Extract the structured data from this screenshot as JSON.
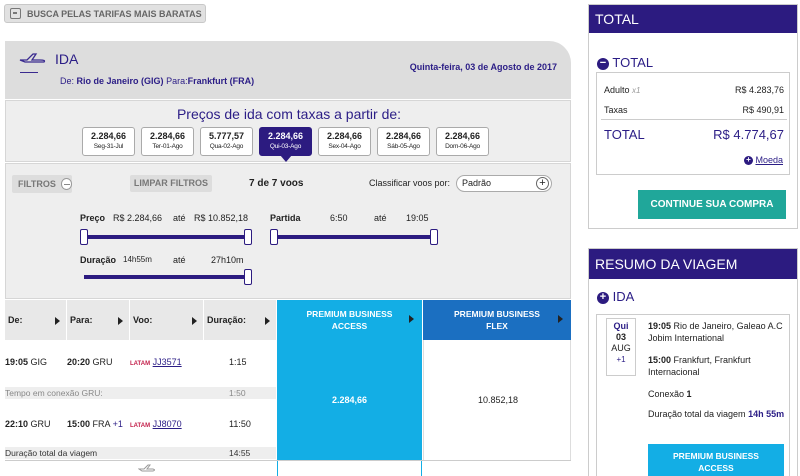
{
  "search_button": {
    "label": "BUSCA PELAS TARIFAS MAIS BARATAS",
    "icon": "calendar-icon"
  },
  "flight_header": {
    "title": "IDA",
    "route_prefix": "De:",
    "origin": "Rio de Janeiro (GIG)",
    "route_mid": "Para:",
    "destination": "Frankfurt (FRA)",
    "date": "Quinta-feira, 03 de Agosto de 2017"
  },
  "prices": {
    "title": "Preços de ida com taxas a partir de:",
    "dates": [
      {
        "price": "2.284,66",
        "day": "Seg-31-Jul",
        "active": false
      },
      {
        "price": "2.284,66",
        "day": "Ter-01-Ago",
        "active": false
      },
      {
        "price": "5.777,57",
        "day": "Qua-02-Ago",
        "active": false
      },
      {
        "price": "2.284,66",
        "day": "Qui-03-Ago",
        "active": true
      },
      {
        "price": "2.284,66",
        "day": "Sex-04-Ago",
        "active": false
      },
      {
        "price": "2.284,66",
        "day": "Sáb-05-Ago",
        "active": false
      },
      {
        "price": "2.284,66",
        "day": "Dom-06-Ago",
        "active": false
      }
    ]
  },
  "filters": {
    "toggle_label": "FILTROS",
    "clear_label": "LIMPAR FILTROS",
    "count": "7 de 7 voos",
    "sort_label": "Classificar voos por:",
    "sort_value": "Padrão",
    "price_label": "Preço",
    "price_min": "R$ 2.284,66",
    "until": "até",
    "price_max": "R$ 10.852,18",
    "departure_label": "Partida",
    "departure_min": "6:50",
    "departure_max": "19:05",
    "duration_label": "Duração",
    "duration_min": "14h55m",
    "duration_max": "27h10m"
  },
  "table": {
    "headers": {
      "from": "De:",
      "to": "Para:",
      "flight": "Voo:",
      "duration": "Duração:"
    },
    "fare1": "PREMIUM BUSINESS ACCESS",
    "fare2": "PREMIUM BUSINESS FLEX",
    "segments": [
      {
        "dep_time": "19:05",
        "dep_airport": "GIG",
        "arr_time": "20:20",
        "arr_airport": "GRU",
        "arr_plus": "",
        "airline": "LATAM",
        "flight": "JJ3571",
        "duration": "1:15"
      },
      {
        "dep_time": "22:10",
        "dep_airport": "GRU",
        "arr_time": "15:00",
        "arr_airport": "FRA",
        "arr_plus": "+1",
        "airline": "LATAM",
        "flight": "JJ8070",
        "duration": "11:50"
      }
    ],
    "connection_label": "Tempo em conexão GRU:",
    "connection_time": "1:50",
    "total_label": "Duração total da viagem",
    "total_time": "14:55",
    "fare1_price": "2.284,66",
    "fare2_price": "10.852,18"
  },
  "total": {
    "header": "TOTAL",
    "subheader": "TOTAL",
    "adult_label": "Adulto",
    "adult_mult": "x1",
    "adult_value": "R$ 4.283,76",
    "taxes_label": "Taxas",
    "taxes_value": "R$ 490,91",
    "total_label": "TOTAL",
    "total_value": "R$ 4.774,67",
    "currency_link": "Moeda",
    "continue_label": "CONTINUE SUA COMPRA"
  },
  "summary": {
    "header": "RESUMO DA VIAGEM",
    "ida_label": "IDA",
    "day_name": "Qui",
    "day_num": "03",
    "month": "AUG",
    "plus": "+1",
    "dep_time": "19:05",
    "dep_place": "Rio de Janeiro, Galeao A.C Jobim International",
    "arr_time": "15:00",
    "arr_place": "Frankfurt, Frankfurt Internacional",
    "connection_label": "Conexão",
    "connection_count": "1",
    "duration_label": "Duração total da viagem",
    "duration_value": "14h 55m",
    "fare": "PREMIUM BUSINESS ACCESS"
  },
  "colors": {
    "brand_purple": "#2c1b80",
    "fare_access": "#13aee5",
    "fare_flex": "#1b6fc1",
    "continue_green": "#20a79a",
    "latam_red": "#c3204b"
  }
}
